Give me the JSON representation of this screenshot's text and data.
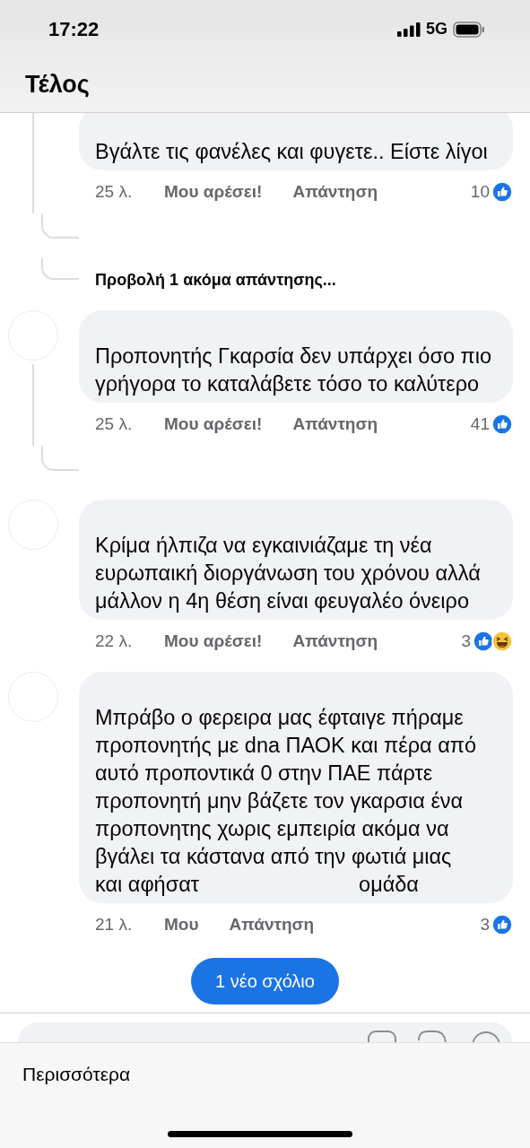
{
  "status_bar": {
    "time": "17:22",
    "network": "5G"
  },
  "header": {
    "title": "Τέλος"
  },
  "comments": [
    {
      "avatar": false,
      "thread_line": true,
      "text": "Βγάλτε τις φανέλες και φυγετε.. Είστε λίγοι",
      "time": "25 λ.",
      "like": "Μου αρέσει!",
      "reply": "Απάντηση",
      "count": "10",
      "reactions": [
        {
          "kind": "like"
        }
      ],
      "reply_stub": true,
      "more_replies": "Προβολή 1 ακόμα απάντησης..."
    },
    {
      "avatar": true,
      "thread_line": true,
      "text": "Προπονητής Γκαρσία δεν υπάρχει όσο πιο γρήγορα το καταλάβετε τόσο το καλύτερο",
      "time": "25 λ.",
      "like": "Μου αρέσει!",
      "reply": "Απάντηση",
      "count": "41",
      "reactions": [
        {
          "kind": "like"
        }
      ],
      "reply_stub": true
    },
    {
      "avatar": true,
      "thread_line": false,
      "text": "Κρίμα ήλπιζα να εγκαινιάζαμε τη νέα ευρωπαική διοργάνωση του χρόνου αλλά μάλλον η 4η θέση είναι φευγαλέο όνειρο",
      "time": "22 λ.",
      "like": "Μου αρέσει!",
      "reply": "Απάντηση",
      "count": "3",
      "reactions": [
        {
          "kind": "like"
        },
        {
          "kind": "haha"
        }
      ],
      "reply_stub": false
    },
    {
      "avatar": true,
      "thread_line": false,
      "text": "Μπράβο ο φερειρα μας έφταιγε πήραμε προπονητής με dna ΠΑΟΚ και πέρα από αυτό προποντικά 0 στην ΠΑΕ πάρτε προπονητή μην βάζετε τον γκαρσια ένα προπονητης χωρις εμπειρία ακόμα να βγάλει τα κάστανα από την φωτιά μιας",
      "text_tail": [
        "και αφήσατ",
        "ομάδα"
      ],
      "time": "21 λ.",
      "like": "Μου",
      "reply": "Απάντηση",
      "count": "3",
      "reactions": [
        {
          "kind": "like"
        }
      ],
      "reply_stub": false
    }
  ],
  "new_comments_pill": "1 νέο σχόλιο",
  "sheet": {
    "more": "Περισσότερα"
  }
}
